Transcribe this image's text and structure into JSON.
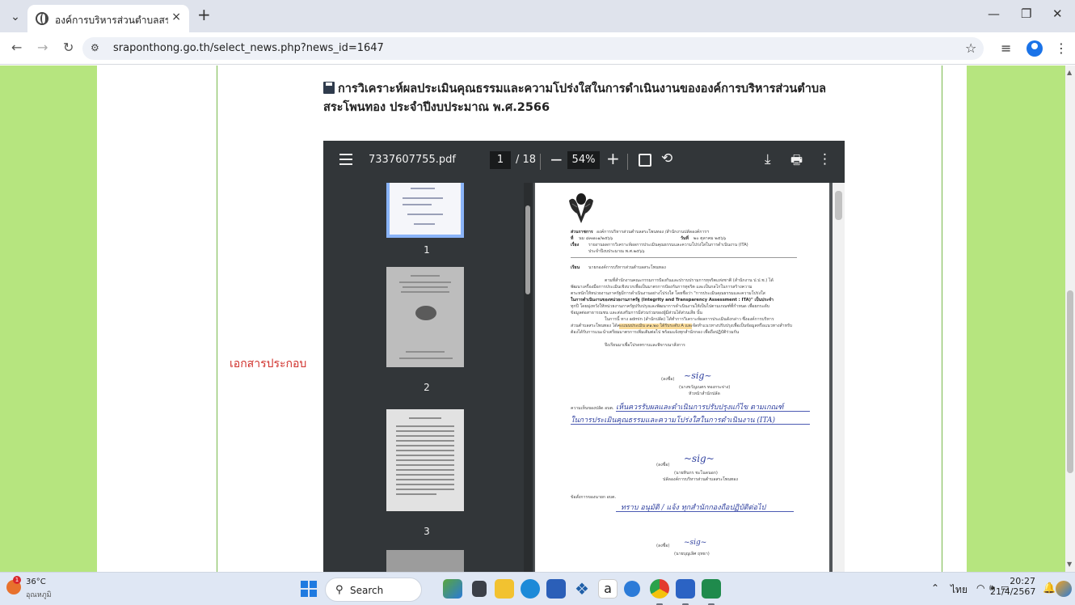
{
  "browser": {
    "tab_title": "องค์การบริหารส่วนตำบลสระโพนทอง",
    "url": "sraponthong.go.th/select_news.php?news_id=1647",
    "new_tab_label": "+",
    "close_tab_label": "×"
  },
  "page": {
    "heading": "การวิเคราะห์ผลประเมินคุณธรรมและความโปร่งใสในการดำเนินงานขององค์การบริหารส่วนตำบลสระโพนทอง ประจำปีงบประมาณ พ.ศ.2566",
    "attachment_label": "เอกสารประกอบ"
  },
  "pdf": {
    "filename": "7337607755.pdf",
    "current_page": "1",
    "total_pages": "/ 18",
    "zoom": "54%",
    "thumbnails": [
      {
        "number": "1"
      },
      {
        "number": "2"
      },
      {
        "number": "3"
      }
    ],
    "document": {
      "agency_label": "ส่วนราชการ",
      "agency": "องค์การบริหารส่วนตำบลสระโพนทอง /สำนักงานปลัดองค์การฯ",
      "ref_label": "ที่",
      "ref": "นม ๘๓๗๐๑/๒๕๖๖",
      "date_label": "วันที่",
      "date": "๒๐ ตุลาคม ๒๕๖๖",
      "subject_label": "เรื่อง",
      "subject": "รายงานผลการวิเคราะห์ผลการประเมินคุณธรรมและความโปร่งใสในการดำเนินงาน (ITA)",
      "subject2": "ประจำปีงบประมาณ พ.ศ.๒๕๖๖",
      "to_label": "เรียน",
      "to": "นายกองค์การบริหารส่วนตำบลสระโพนทอง",
      "para1": [
        "ตามที่สำนักงานคณะกรรมการป้องกันและปราบปรามการทุจริตแห่งชาติ (สำนักงาน ป.ป.ช.) ได้",
        "พัฒนาเครื่องมือการประเมินเชิงบวกเพื่อเป็นมาตรการป้องกันการทุจริต และเป็นกลไกในการสร้างความ",
        "ตระหนักให้หน่วยงานภาครัฐมีการดำเนินงานอย่างโปร่งใส โดยชื่อว่า \"การประเมินคุณธรรมและความโปร่งใส",
        "ในการดำเนินงานของหน่วยงานภาครัฐ (Integrity and Transparency Assessment : ITA)\" เป็นประจำ",
        "ทุกปี โดยมุ่งหวังให้หน่วยงานภาครัฐปรับปรุงและพัฒนาการดำเนินงานให้เป็นไปตามเกณฑ์ที่กำหนด เพื่อยกระดับ",
        "ข้อมูลต่อสาธารณชน และส่งเสริมการมีส่วนร่วมของผู้มีส่วนได้ส่วนเสีย นั้น"
      ],
      "para2": [
        "ในการนี้ ทาง admin (สำนักปลัด) ได้ทำการวิเคราะห์ผลการประเมินดังกล่าว ซึ่งองค์การบริหาร",
        "ส่วนตำบลสระโพนทอง ได้คะแนนประเมิน ๙๑.๒๐ ได้รับระดับ A และจัดทำแนวทางปรับปรุงเพื่อเป็นข้อมูลหรือแนวทางสำหรับ",
        "ต้องได้รับการแนะนำเตรียมมาตรการเพิ่มเติมต่อไป พร้อมแจ้งทุกสำนักกอง เพื่อถือปฏิบัติร่วมกัน"
      ],
      "closing": "จึงเรียนมาเพื่อโปรดทราบและพิจารณาสั่งการ",
      "sign1_label": "(ลงชื่อ)",
      "sign1_name": "(นางขวัญเนตร ทองกระจ่าง)",
      "sign1_title": "หัวหน้าสำนักปลัด",
      "opinion_label": "ความเห็นของปลัด อบต.",
      "hand1": "เห็นควรรับผลและดำเนินการปรับปรุงแก้ไข ตามเกณฑ์",
      "hand2": "ในการประเมินคุณธรรมและความโปร่งใสในการดำเนินงาน (ITA)",
      "sign2_label": "(ลงชื่อ)",
      "sign2_name": "(นายทินกร ชะโนดนอก)",
      "sign2_title": "ปลัดองค์การบริหารส่วนตำบลสระโพนทอง",
      "order_label": "ข้อสั่งการของนายก อบต.",
      "hand3": "ทราบ อนุมัติ / แจ้ง ทุกสำนักกองถือปฏิบัติต่อไป",
      "sign3_label": "(ลงชื่อ)",
      "sign3_name": "(นายบุญเลิศ ฤทธา)"
    }
  },
  "taskbar": {
    "temperature": "36°C",
    "condition": "อุณหภูมิ",
    "weather_badge": "1",
    "search_label": "Search",
    "language": "ไทย",
    "time": "20:27",
    "date": "21/4/2567"
  },
  "colors": {
    "page_background": "#b6e57f",
    "attachment_label": "#d0302b",
    "pdf_toolbar": "#323639",
    "taskbar": "#dfe7f4"
  }
}
